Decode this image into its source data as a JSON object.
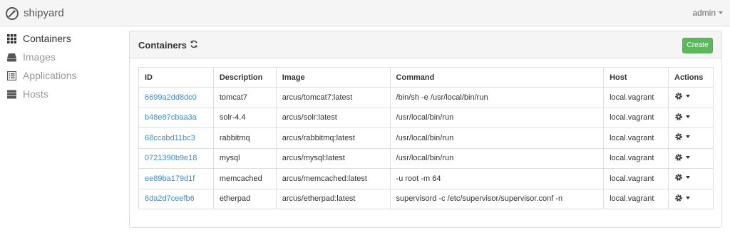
{
  "navbar": {
    "brand": "shipyard",
    "brand_icon": "shipyard-logo-icon",
    "user": "admin"
  },
  "sidebar": {
    "items": [
      {
        "label": "Containers",
        "icon": "grid-icon",
        "active": true
      },
      {
        "label": "Images",
        "icon": "hdd-icon",
        "active": false
      },
      {
        "label": "Applications",
        "icon": "list-alt-icon",
        "active": false
      },
      {
        "label": "Hosts",
        "icon": "tasks-icon",
        "active": false
      }
    ]
  },
  "panel": {
    "title": "Containers",
    "create_label": "Create",
    "refresh_icon": "refresh-icon"
  },
  "table": {
    "headers": [
      "ID",
      "Description",
      "Image",
      "Command",
      "Host",
      "Actions"
    ],
    "rows": [
      {
        "id": "6699a2dd8dc0",
        "description": "tomcat7",
        "image": "arcus/tomcat7:latest",
        "command": "/bin/sh -e /usr/local/bin/run",
        "host": "local.vagrant"
      },
      {
        "id": "b48e87cbaa3a",
        "description": "solr-4.4",
        "image": "arcus/solr:latest",
        "command": "/usr/local/bin/run",
        "host": "local.vagrant"
      },
      {
        "id": "68ccabd11bc3",
        "description": "rabbitmq",
        "image": "arcus/rabbitmq:latest",
        "command": "/usr/local/bin/run",
        "host": "local.vagrant"
      },
      {
        "id": "0721390b9e18",
        "description": "mysql",
        "image": "arcus/mysql:latest",
        "command": "/usr/local/bin/run",
        "host": "local.vagrant"
      },
      {
        "id": "ee89ba179d1f",
        "description": "memcached",
        "image": "arcus/memcached:latest",
        "command": "-u root -m 64",
        "host": "local.vagrant"
      },
      {
        "id": "6da2d7ceefb6",
        "description": "etherpad",
        "image": "arcus/etherpad:latest",
        "command": "supervisord -c /etc/supervisor/supervisor.conf -n",
        "host": "local.vagrant"
      }
    ]
  },
  "colors": {
    "link": "#428bca",
    "create_button": "#5cb85c",
    "nav_active": "#333333",
    "nav_inactive": "#999999"
  }
}
